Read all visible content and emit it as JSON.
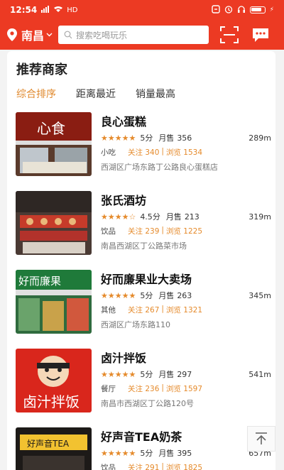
{
  "status_bar": {
    "time": "12:54",
    "signal": "···· ····",
    "network": "HD"
  },
  "header": {
    "city": "南昌",
    "search_placeholder": "搜索吃喝玩乐"
  },
  "section_title": "推荐商家",
  "tabs": [
    {
      "label": "综合排序",
      "active": true
    },
    {
      "label": "距离最近",
      "active": false
    },
    {
      "label": "销量最高",
      "active": false
    }
  ],
  "labels": {
    "score_unit": "分",
    "monthly_sales": "月售",
    "follow": "关注",
    "views": "浏览",
    "separator": "|"
  },
  "shops": [
    {
      "name": "良心蛋糕",
      "stars": "★★★★★",
      "score": "5",
      "sales": "356",
      "distance": "289m",
      "category": "小吃",
      "follows": "340",
      "views": "1534",
      "address": "西湖区广场东路丁公路良心蛋糕店",
      "sign_text": "心食"
    },
    {
      "name": "张氏酒坊",
      "stars": "★★★★☆",
      "score": "4.5",
      "sales": "213",
      "distance": "319m",
      "category": "饮品",
      "follows": "239",
      "views": "1225",
      "address": "南昌西湖区丁公路菜市场"
    },
    {
      "name": "好而廉果业大卖场",
      "stars": "★★★★★",
      "score": "5",
      "sales": "263",
      "distance": "345m",
      "category": "其他",
      "follows": "267",
      "views": "1321",
      "address": "西湖区广场东路110",
      "sign_text": "好而廉果"
    },
    {
      "name": "卤汁拌饭",
      "stars": "★★★★★",
      "score": "5",
      "sales": "297",
      "distance": "541m",
      "category": "餐厅",
      "follows": "236",
      "views": "1597",
      "address": "南昌市西湖区丁公路120号",
      "sign_text": "卤汁拌饭"
    },
    {
      "name": "好声音TEA奶茶",
      "stars": "★★★★★",
      "score": "5",
      "sales": "395",
      "distance": "657m",
      "category": "饮品",
      "follows": "291",
      "views": "1825",
      "address": "",
      "sign_text": "好声音TEA"
    }
  ],
  "colors": {
    "brand_red": "#ec3a23",
    "accent_orange": "#e58a2b"
  }
}
